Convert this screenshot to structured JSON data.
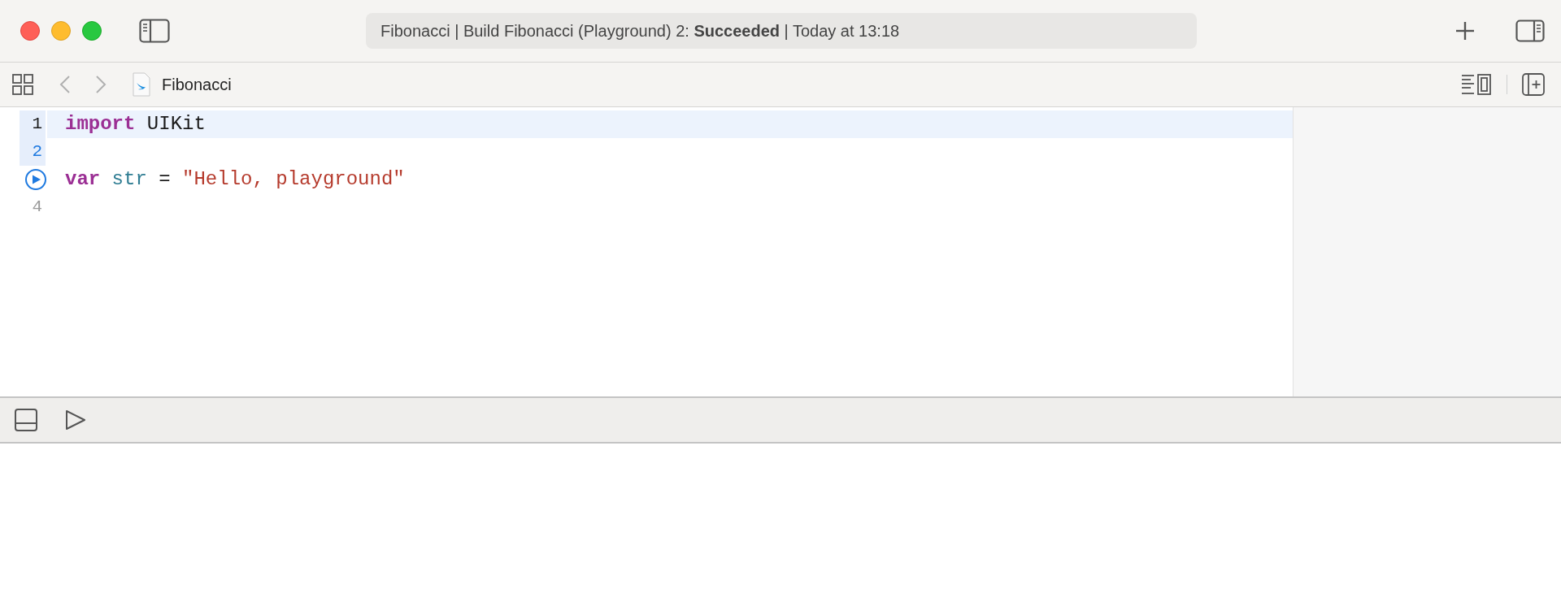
{
  "window": {
    "status": "Fibonacci | Build Fibonacci (Playground) 2: **Succeeded** | Today at 13:18"
  },
  "toolbar": {
    "file_name": "Fibonacci"
  },
  "editor": {
    "lines": [
      {
        "kind": "number",
        "number": "1",
        "executed": true,
        "current": true,
        "tokens": [
          {
            "text": "import",
            "kind": "keyword"
          },
          {
            "text": " UIKit",
            "kind": "plain"
          }
        ]
      },
      {
        "kind": "number",
        "number": "2",
        "executed": true,
        "current": false
      },
      {
        "kind": "run",
        "executed": false,
        "current": false,
        "tokens": [
          {
            "text": "var",
            "kind": "keyword"
          },
          {
            "text": " str",
            "kind": "identifier"
          },
          {
            "text": " = ",
            "kind": "plain"
          },
          {
            "text": "\"Hello, playground\"",
            "kind": "string"
          }
        ]
      },
      {
        "kind": "number",
        "number": "4",
        "executed": false,
        "current": false
      }
    ]
  }
}
